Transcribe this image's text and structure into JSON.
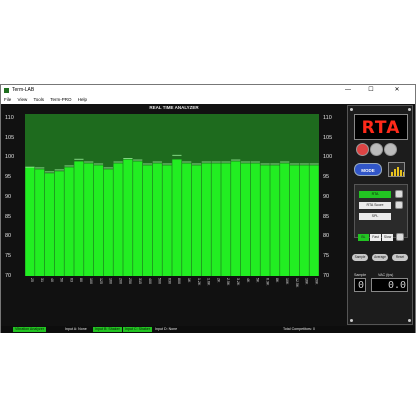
{
  "window": {
    "title": "Term-LAB",
    "controls": [
      "—",
      "☐",
      "✕"
    ]
  },
  "menu": [
    "File",
    "View",
    "Tools",
    "Term-PRO",
    "Help"
  ],
  "rta": {
    "title": "REAL TIME ANALYZER"
  },
  "chart_data": {
    "type": "bar",
    "title": "REAL TIME ANALYZER",
    "categories": [
      "25",
      "31",
      "40",
      "50",
      "63",
      "80",
      "100",
      "125",
      "160",
      "200",
      "250",
      "315",
      "400",
      "500",
      "630",
      "800",
      "1K",
      "1.2K",
      "1.6K",
      "2K",
      "2.5K",
      "3.2K",
      "4K",
      "5K",
      "6.3K",
      "8K",
      "10K",
      "12.5K",
      "16K",
      "20K"
    ],
    "values": [
      97.5,
      97.0,
      96.0,
      96.5,
      97.5,
      99.0,
      98.5,
      98.0,
      97.0,
      98.5,
      99.5,
      99.0,
      98.0,
      98.5,
      98.0,
      99.5,
      98.5,
      98.0,
      98.5,
      98.5,
      98.5,
      99.0,
      98.5,
      98.5,
      98.0,
      98.0,
      98.5,
      98.0,
      98.0,
      98.0
    ],
    "peaks": [
      97.5,
      97.3,
      96.3,
      96.8,
      97.8,
      99.5,
      98.8,
      98.3,
      97.3,
      98.8,
      99.7,
      99.3,
      98.3,
      98.8,
      98.3,
      100.5,
      98.8,
      98.3,
      98.8,
      98.8,
      98.8,
      99.3,
      98.8,
      98.8,
      98.3,
      98.3,
      98.8,
      98.3,
      98.3,
      98.3
    ],
    "ylim": [
      70,
      111
    ],
    "yticks": [
      70,
      75,
      80,
      85,
      90,
      95,
      100,
      105,
      110
    ],
    "colors": {
      "bar": "#22ee22",
      "background": "#1e6b1e",
      "peak": "#9af09a"
    }
  },
  "panel": {
    "logo_text": "RTA",
    "mode_label": "MODE",
    "options": [
      {
        "label": "RTA",
        "selected": true
      },
      {
        "label": "RTA Score",
        "selected": false
      },
      {
        "label": "SPL",
        "selected": false
      }
    ],
    "weighting": [
      {
        "label": "BL",
        "selected": true
      },
      {
        "label": "Fast",
        "selected": false
      },
      {
        "label": "Slow",
        "selected": false
      }
    ],
    "pills": [
      "Sample",
      "Average",
      "Reset"
    ],
    "sample_label": "Sample",
    "sample_value": "0",
    "vac_label": "VAC (fps)",
    "vac_value": "0.0"
  },
  "status": {
    "items": [
      {
        "label": "Vibration Analyzer",
        "on": true
      },
      {
        "label": "Input A: None",
        "on": false
      },
      {
        "label": "Input B: Shaker",
        "on": true
      },
      {
        "label": "Input C: Shaker",
        "on": true
      },
      {
        "label": "Input D: None",
        "on": false
      }
    ],
    "total": "Total Competitors: 0"
  }
}
